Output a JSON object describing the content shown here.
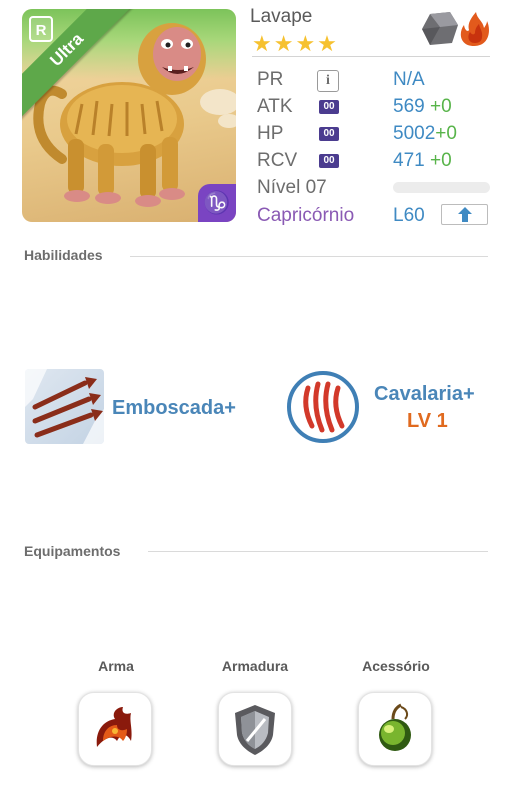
{
  "pet": {
    "name": "Lavape",
    "rarity": "Ultra",
    "rank": "R",
    "stars": "★★★★",
    "star_count": 4
  },
  "stats": {
    "pr_label": "PR",
    "pr_value": "N/A",
    "info_icon": "i",
    "atk_label": "ATK",
    "atk_box": "00",
    "atk_value": "569",
    "atk_bonus": "+0",
    "hp_label": "HP",
    "hp_box": "00",
    "hp_value": "5002",
    "hp_bonus": "+0",
    "rcv_label": "RCV",
    "rcv_box": "00",
    "rcv_value": "471",
    "rcv_bonus": "+0",
    "level_label": "Nível 07",
    "sign_label": "Capricórnio",
    "level_cap": "L60"
  },
  "sections": {
    "skills_title": "Habilidades",
    "equipment_title": "Equipamentos"
  },
  "skills": [
    {
      "name": "Emboscada+"
    },
    {
      "name": "Cavalaria+",
      "level": "LV 1"
    }
  ],
  "equipment": [
    {
      "label": "Arma"
    },
    {
      "label": "Armadura"
    },
    {
      "label": "Acessório"
    }
  ],
  "colors": {
    "accent_blue": "#3f8ac3",
    "bonus_green": "#58b44a",
    "sign_purple": "#8a5ab4",
    "skill_level_orange": "#e06a1f",
    "rarity_green": "#5ea84a"
  },
  "icons": {
    "element_primary": "rock-icon",
    "element_secondary": "fire-icon",
    "sign_corner": "capricorn-icon",
    "upgrade": "arrow-up-icon"
  }
}
